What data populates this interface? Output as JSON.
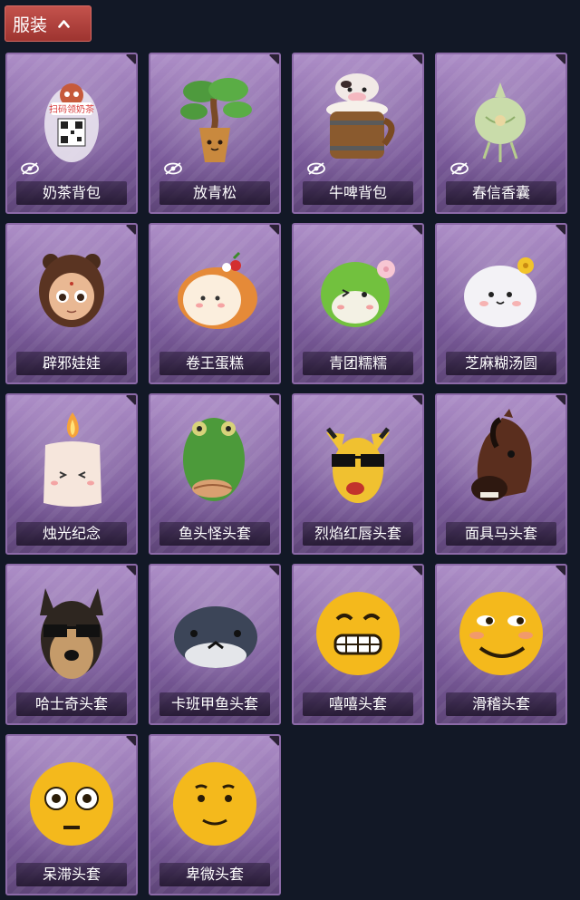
{
  "header": {
    "title": "服装",
    "expand_icon": "chevron-up-icon"
  },
  "items": [
    {
      "name": "奶茶背包",
      "hidden_icon": true,
      "art": "milk-tea-backpack",
      "art_text": "扫码领奶茶"
    },
    {
      "name": "放青松",
      "hidden_icon": true,
      "art": "bonsai-pine"
    },
    {
      "name": "牛啤背包",
      "hidden_icon": true,
      "art": "cow-beer-mug"
    },
    {
      "name": "春信香囊",
      "hidden_icon": true,
      "art": "sachet"
    },
    {
      "name": "辟邪娃娃",
      "art": "doll-head"
    },
    {
      "name": "卷王蛋糕",
      "art": "swiss-roll"
    },
    {
      "name": "青团糯糯",
      "art": "green-dumpling"
    },
    {
      "name": "芝麻糊汤圆",
      "art": "white-tangyuan"
    },
    {
      "name": "烛光纪念",
      "art": "candle"
    },
    {
      "name": "鱼头怪头套",
      "art": "fish-head"
    },
    {
      "name": "烈焰红唇头套",
      "art": "yellow-mask-sunglasses"
    },
    {
      "name": "面具马头套",
      "art": "horse-head"
    },
    {
      "name": "哈士奇头套",
      "art": "husky-sunglasses"
    },
    {
      "name": "卡班甲鱼头套",
      "art": "armored-fish"
    },
    {
      "name": "嘻嘻头套",
      "art": "grin-emoji"
    },
    {
      "name": "滑稽头套",
      "art": "smirk-emoji"
    },
    {
      "name": "呆滞头套",
      "art": "flushed-emoji"
    },
    {
      "name": "卑微头套",
      "art": "shy-emoji"
    }
  ],
  "colors": {
    "background": "#121826",
    "header": "#b0433e",
    "card": "#8c6aa8"
  }
}
